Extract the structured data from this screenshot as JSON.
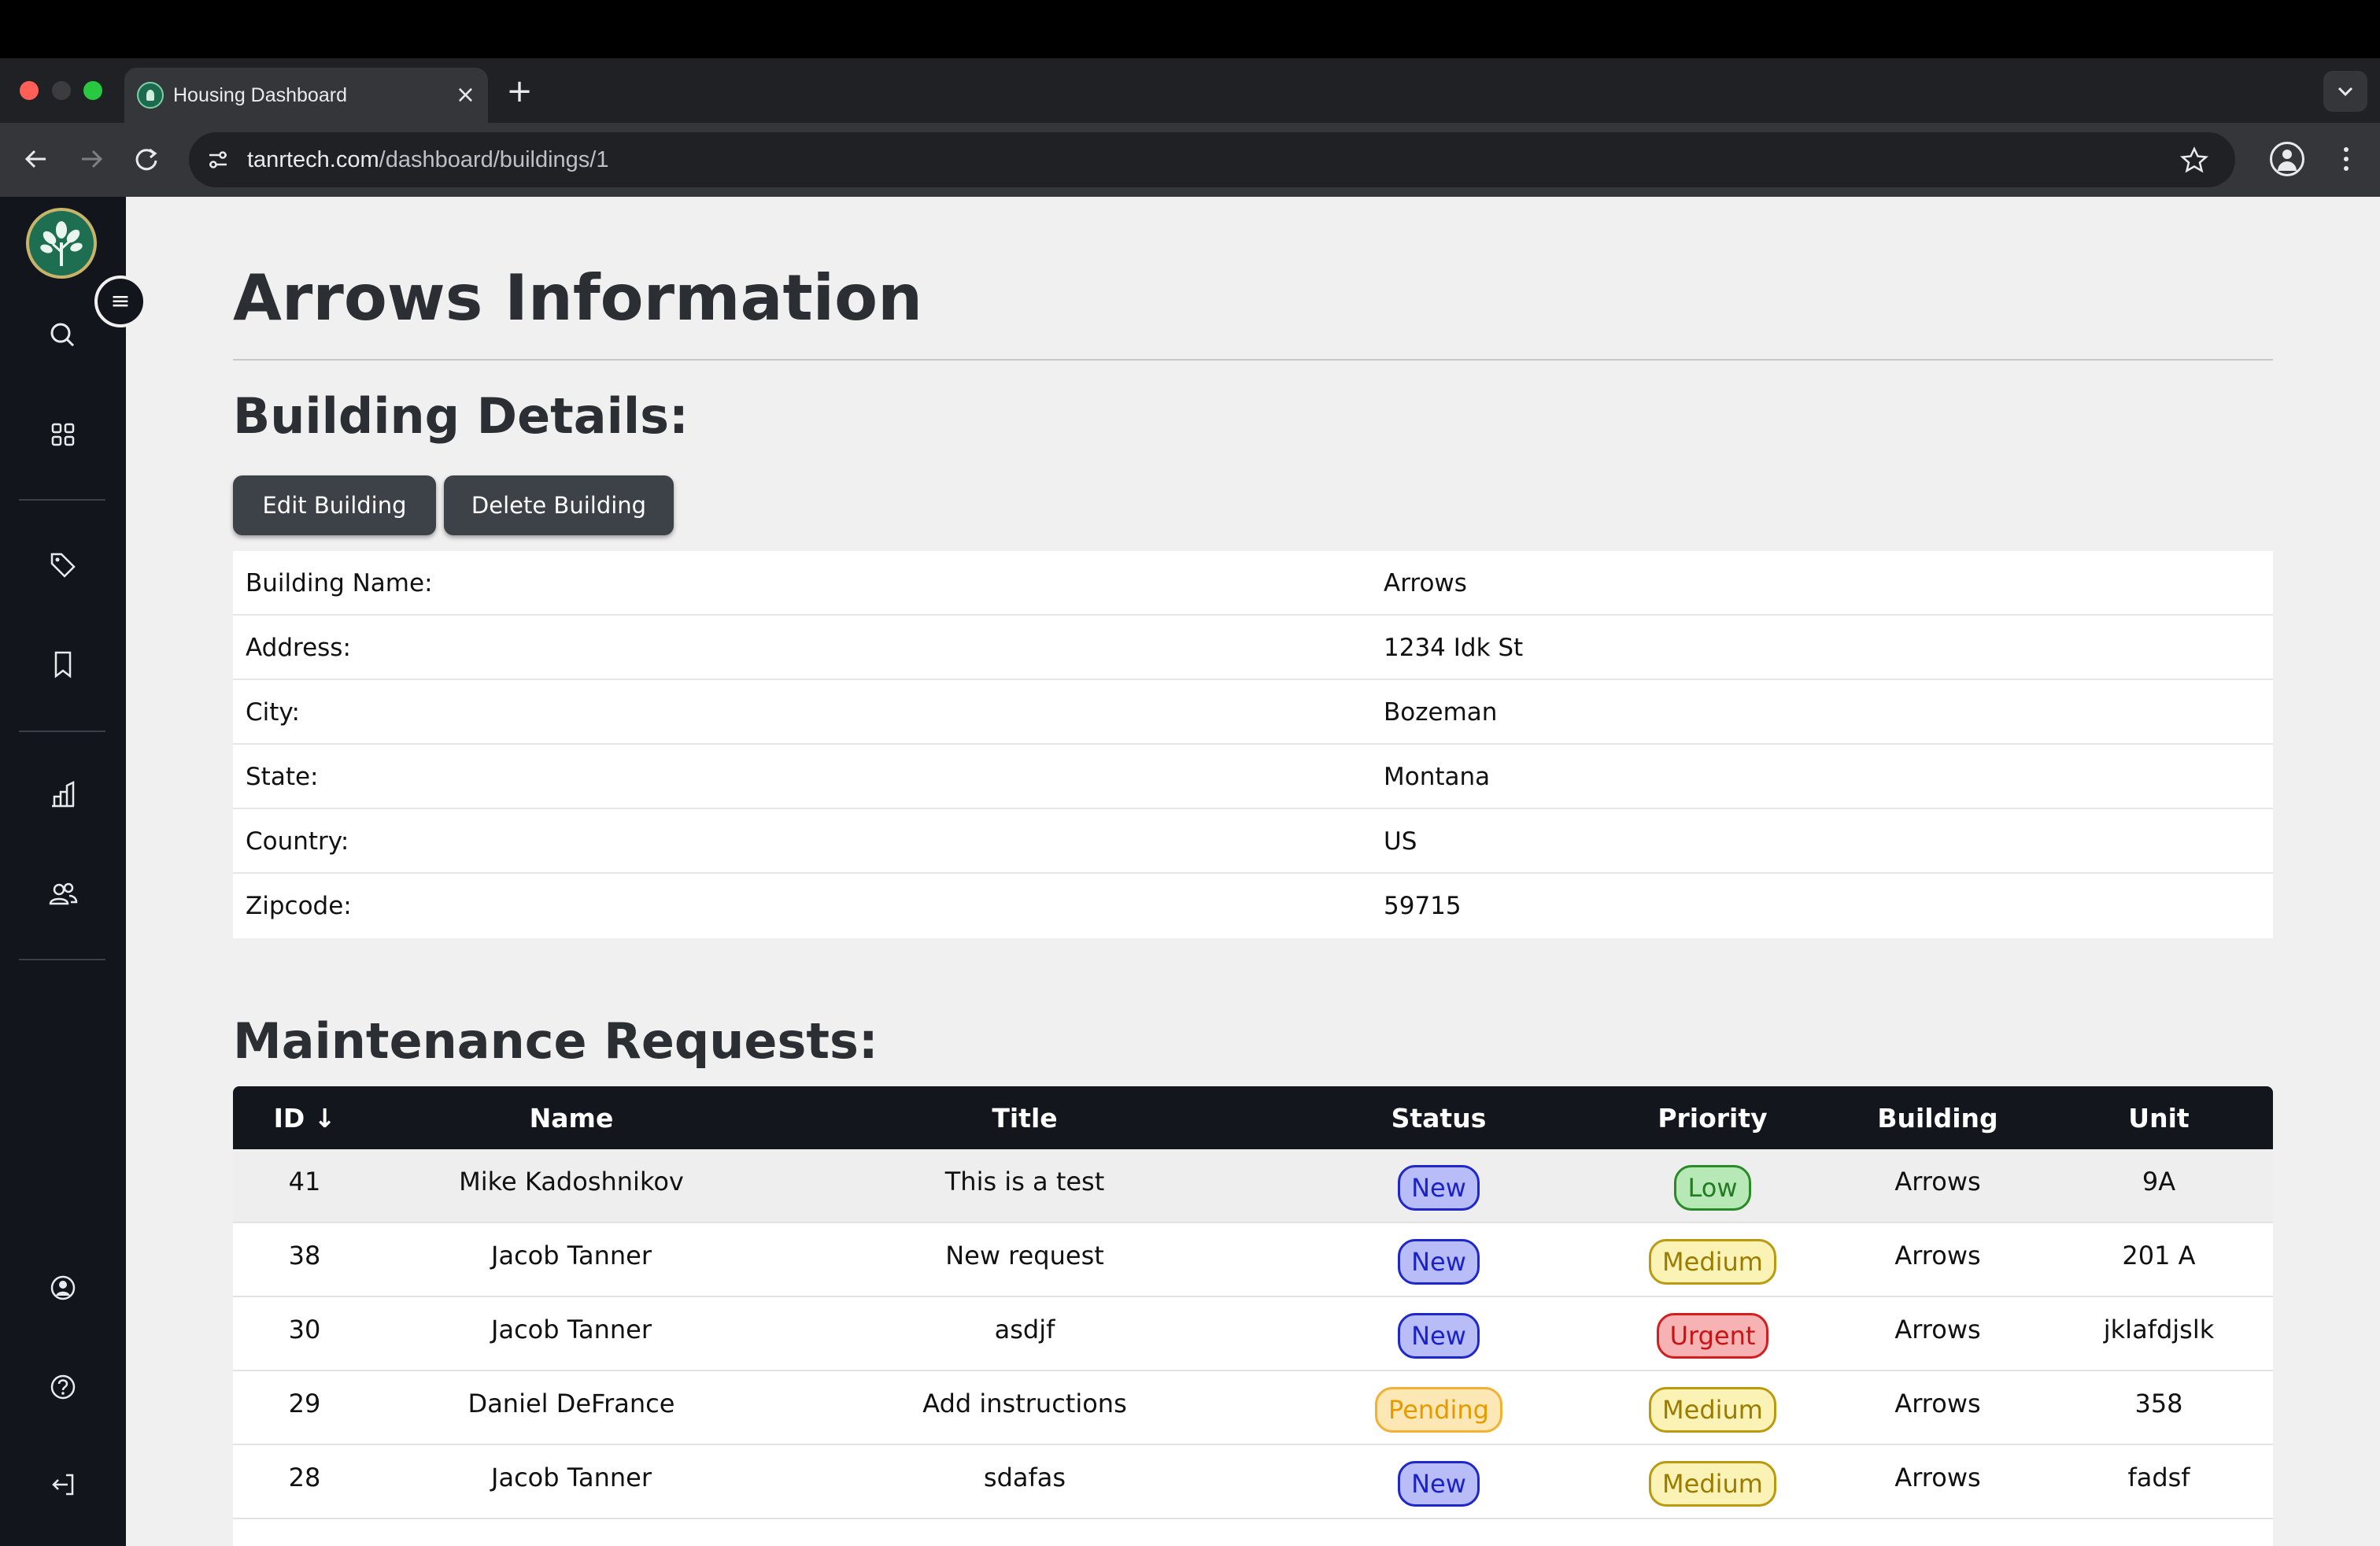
{
  "browser": {
    "tab_title": "Housing Dashboard",
    "tab_close": "×",
    "new_tab": "+",
    "url_host": "tanrtech.com",
    "url_path": "/dashboard/buildings/1"
  },
  "sidebar": {
    "toggle_glyph": "≡",
    "items": [
      "search-icon",
      "dashboard-grid-icon",
      "tags-icon",
      "bookmark-icon",
      "buildings-icon",
      "users-icon",
      "account-icon",
      "help-icon",
      "logout-icon"
    ]
  },
  "page": {
    "title": "Arrows Information",
    "details_heading": "Building Details:",
    "edit_button": "Edit Building",
    "delete_button": "Delete Building",
    "details": [
      {
        "label": "Building Name:",
        "value": "Arrows"
      },
      {
        "label": "Address:",
        "value": "1234 Idk St"
      },
      {
        "label": "City:",
        "value": "Bozeman"
      },
      {
        "label": "State:",
        "value": "Montana"
      },
      {
        "label": "Country:",
        "value": "US"
      },
      {
        "label": "Zipcode:",
        "value": "59715"
      }
    ],
    "maintenance_heading": "Maintenance Requests:"
  },
  "maintenance": {
    "headers": {
      "id": "ID ↓",
      "name": "Name",
      "title": "Title",
      "status": "Status",
      "priority": "Priority",
      "building": "Building",
      "unit": "Unit"
    },
    "rows": [
      {
        "id": "41",
        "name": "Mike Kadoshnikov",
        "title": "This is a test",
        "status": "New",
        "priority": "Low",
        "building": "Arrows",
        "unit": "9A"
      },
      {
        "id": "38",
        "name": "Jacob Tanner",
        "title": "New request",
        "status": "New",
        "priority": "Medium",
        "building": "Arrows",
        "unit": "201 A"
      },
      {
        "id": "30",
        "name": "Jacob Tanner",
        "title": "asdjf",
        "status": "New",
        "priority": "Urgent",
        "building": "Arrows",
        "unit": "jklafdjslk"
      },
      {
        "id": "29",
        "name": "Daniel DeFrance",
        "title": "Add instructions",
        "status": "Pending",
        "priority": "Medium",
        "building": "Arrows",
        "unit": "358"
      },
      {
        "id": "28",
        "name": "Jacob Tanner",
        "title": "sdafas",
        "status": "New",
        "priority": "Medium",
        "building": "Arrows",
        "unit": "fadsf"
      }
    ]
  },
  "colors": {
    "sidebar_bg": "#12161c",
    "button_bg": "#3d4248",
    "status_new": "#2027c9",
    "status_pending": "#f2b134",
    "priority_low": "#2a8a2a",
    "priority_medium": "#b99a10",
    "priority_urgent": "#d21e1e"
  }
}
